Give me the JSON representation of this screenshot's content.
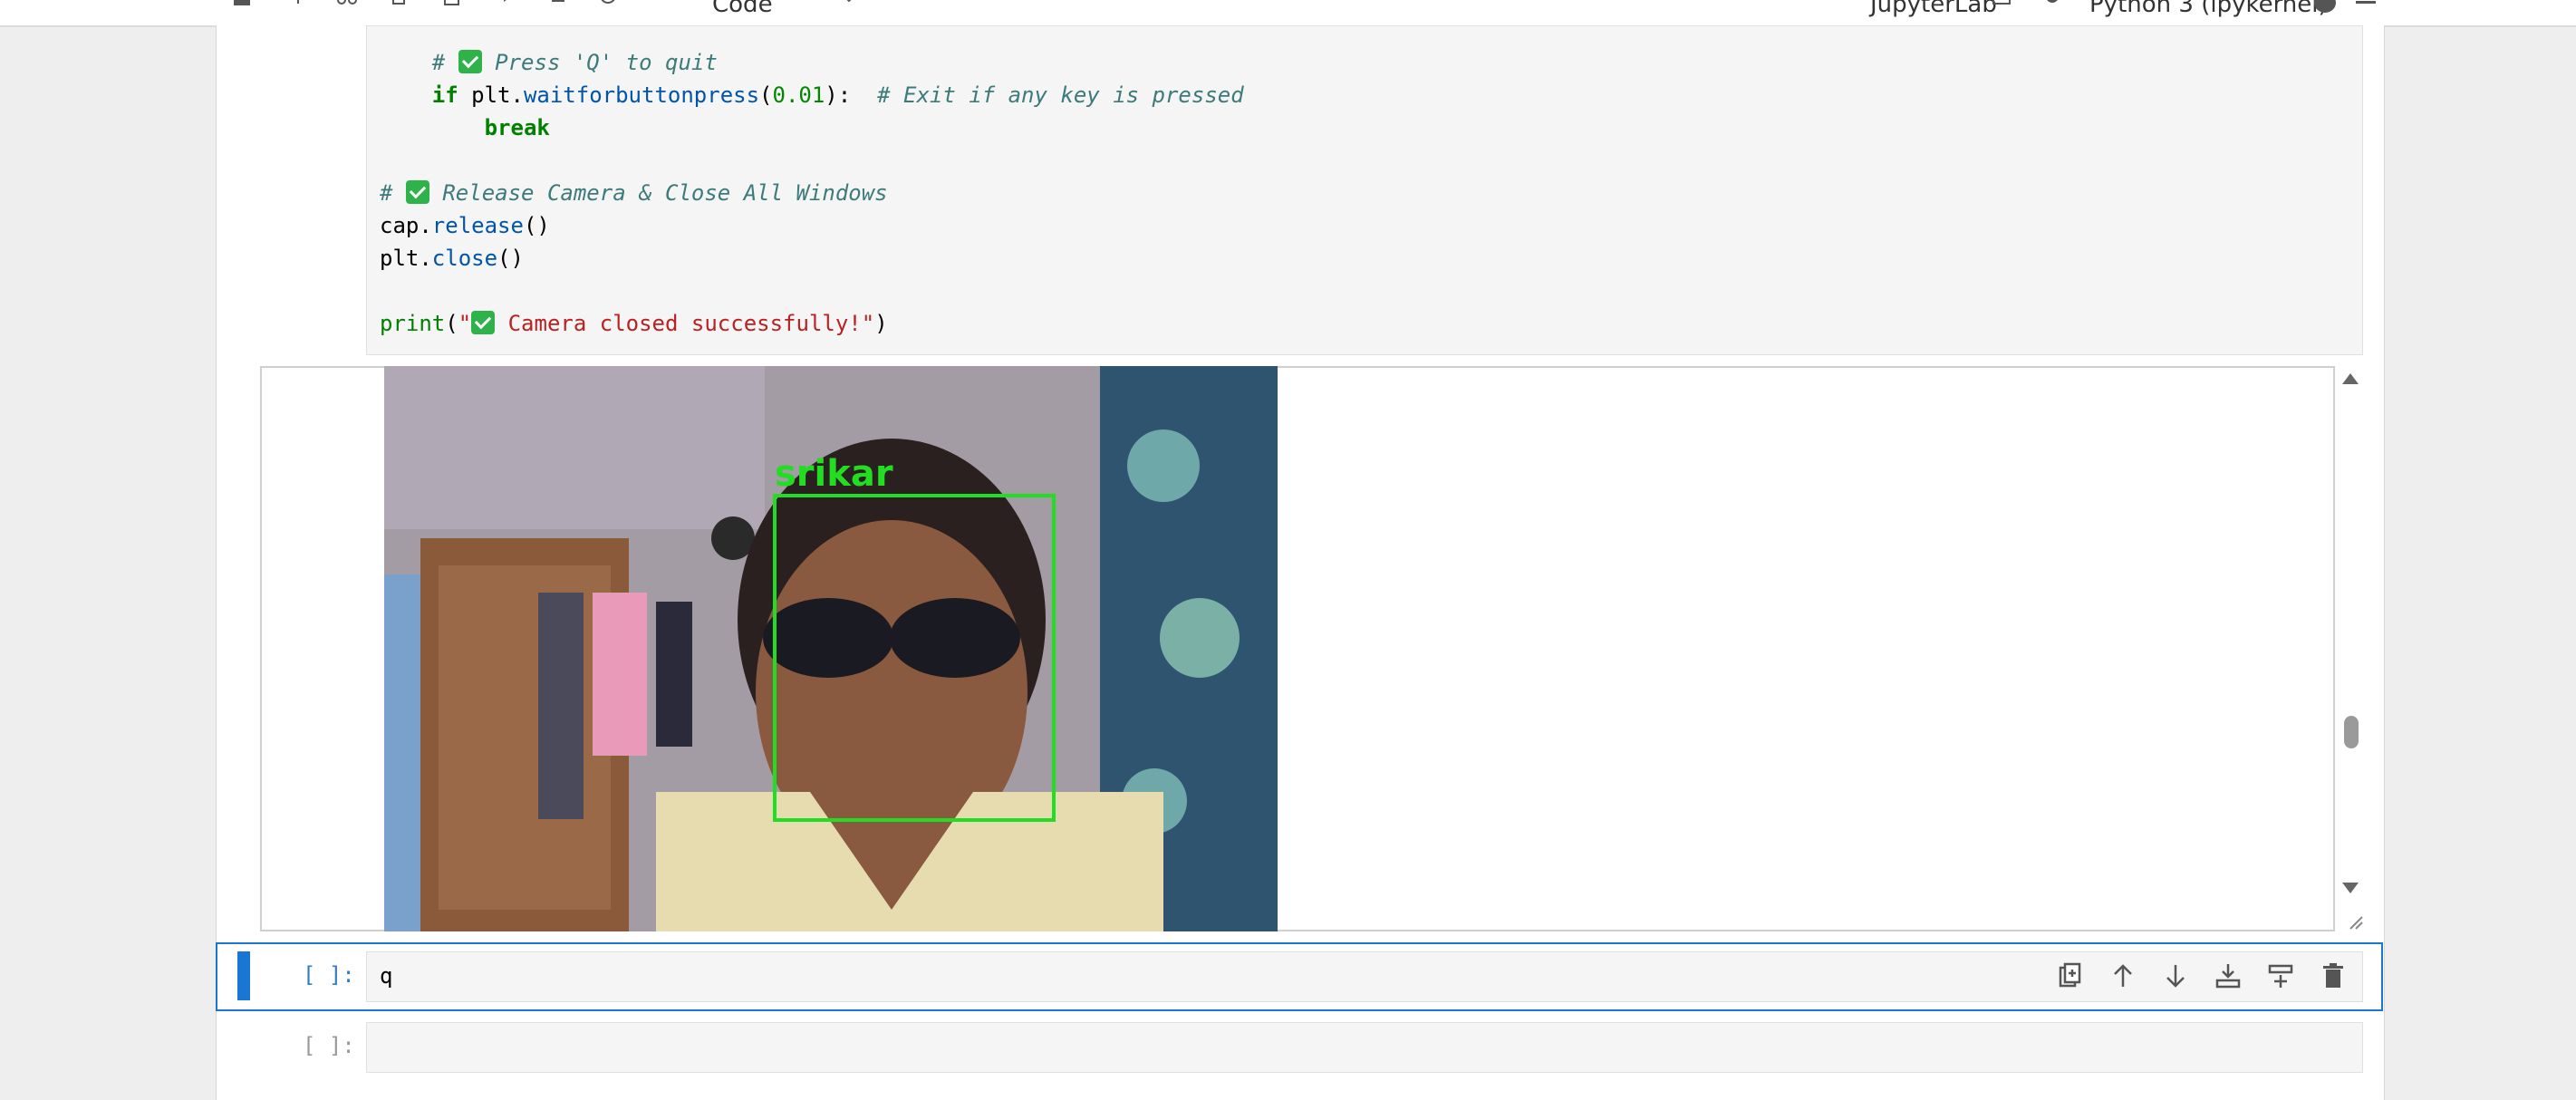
{
  "toolbar": {
    "cell_type": "Code",
    "app_name": "JupyterLab",
    "kernel_name": "Python 3 (ipykernel)"
  },
  "code_cell": {
    "lines": [
      {
        "indent": "    ",
        "comment_prefix": "# ",
        "comment_text": " Press 'Q' to quit"
      },
      {
        "indent": "    ",
        "kw": "if",
        "obj": " plt.",
        "fn": "waitforbuttonpress",
        "open": "(",
        "num": "0.01",
        "close": "):",
        "comment": "  # Exit if any key is pressed"
      },
      {
        "indent": "        ",
        "kw": "break"
      },
      {
        "blank": true
      },
      {
        "comment_prefix": "# ",
        "comment_text": " Release Camera & Close All Windows"
      },
      {
        "obj": "cap.",
        "fn": "release",
        "rest": "()"
      },
      {
        "obj": "plt.",
        "fn": "close",
        "rest": "()"
      },
      {
        "blank": true
      },
      {
        "bi": "print",
        "open": "(",
        "str_start": "\"",
        "str_text": " Camera closed successfully!\"",
        "close": ")"
      }
    ]
  },
  "output": {
    "detection_label": "srikar",
    "box_color": "#22dd22"
  },
  "cells": [
    {
      "prompt": "[ ]:",
      "source": "q",
      "active": true
    },
    {
      "prompt": "[ ]:",
      "source": "",
      "active": false
    }
  ],
  "colors": {
    "accent": "#1976d2",
    "check_green": "#2fb24a"
  }
}
